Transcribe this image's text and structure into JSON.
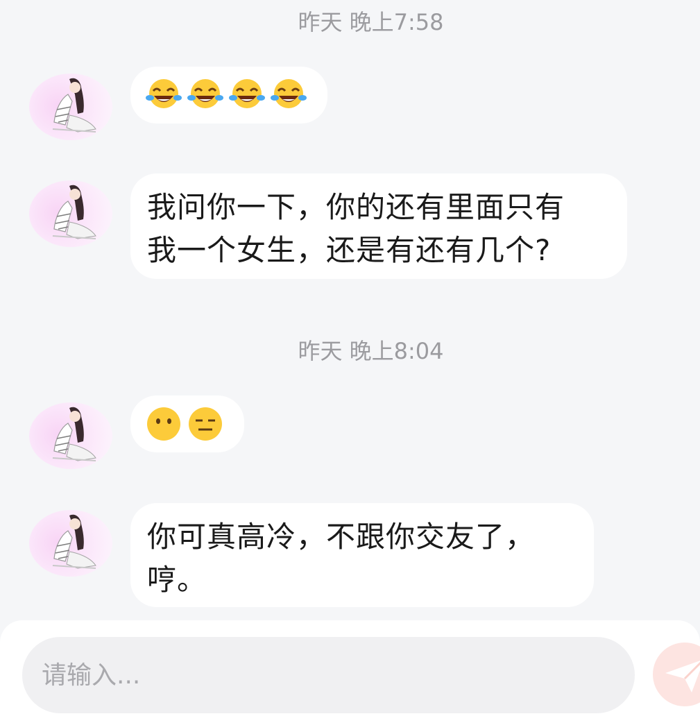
{
  "messages": [
    {
      "type": "timestamp",
      "text": "昨天 晚上7:58"
    },
    {
      "type": "emoji",
      "sender": "other",
      "emojis": [
        "tears-of-joy",
        "tears-of-joy",
        "tears-of-joy",
        "tears-of-joy"
      ]
    },
    {
      "type": "text",
      "sender": "other",
      "lines": [
        "我问你一下，你的还有里面只有",
        "我一个女生，还是有还有几个?"
      ]
    },
    {
      "type": "timestamp",
      "text": "昨天 晚上8:04"
    },
    {
      "type": "emoji",
      "sender": "other",
      "emojis": [
        "face-without-mouth",
        "expressionless-face"
      ]
    },
    {
      "type": "text",
      "sender": "other",
      "lines": [
        "你可真高冷，不跟你交友了，",
        "哼。"
      ]
    }
  ],
  "input": {
    "placeholder": "请输入..."
  },
  "colors": {
    "background": "#f5f6f8",
    "bubble": "#ffffff",
    "timestamp": "#9b9b9f",
    "send_button": "#fde4e1",
    "send_icon": "#ffffff"
  }
}
